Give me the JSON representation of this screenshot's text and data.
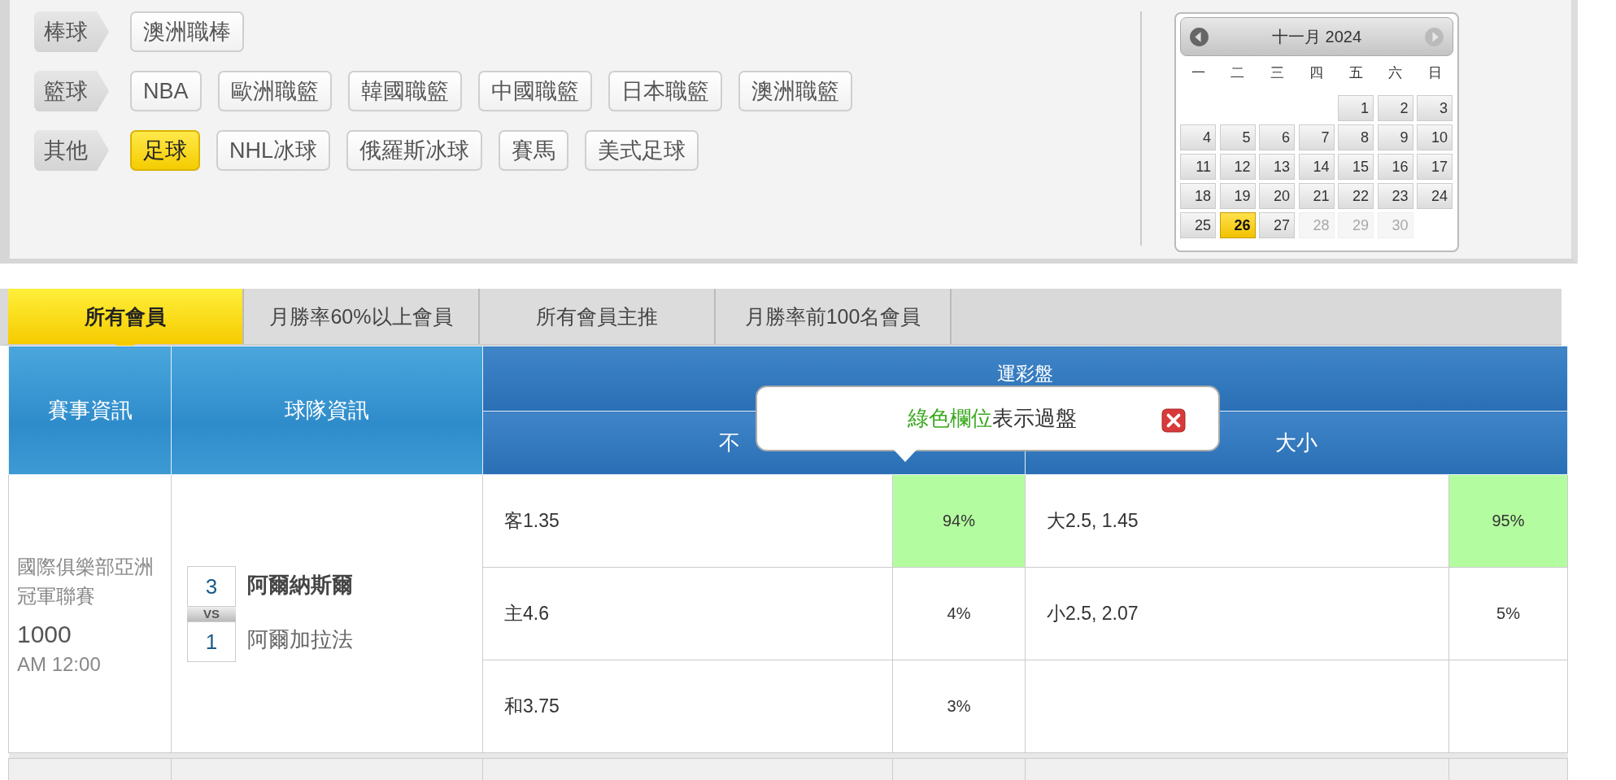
{
  "categories": [
    {
      "label": "棒球",
      "items": [
        {
          "label": "澳洲職棒",
          "selected": false
        }
      ]
    },
    {
      "label": "籃球",
      "items": [
        {
          "label": "NBA",
          "selected": false
        },
        {
          "label": "歐洲職籃",
          "selected": false
        },
        {
          "label": "韓國職籃",
          "selected": false
        },
        {
          "label": "中國職籃",
          "selected": false
        },
        {
          "label": "日本職籃",
          "selected": false
        },
        {
          "label": "澳洲職籃",
          "selected": false
        }
      ]
    },
    {
      "label": "其他",
      "items": [
        {
          "label": "足球",
          "selected": true
        },
        {
          "label": "NHL冰球",
          "selected": false
        },
        {
          "label": "俄羅斯冰球",
          "selected": false
        },
        {
          "label": "賽馬",
          "selected": false
        },
        {
          "label": "美式足球",
          "selected": false
        }
      ]
    }
  ],
  "calendar": {
    "title": "十一月 2024",
    "weekdays": [
      "一",
      "二",
      "三",
      "四",
      "五",
      "六",
      "日"
    ],
    "days": [
      {
        "kind": "blank"
      },
      {
        "kind": "blank"
      },
      {
        "kind": "blank"
      },
      {
        "kind": "blank"
      },
      {
        "kind": "day",
        "label": "1",
        "selected": false,
        "disabled": false
      },
      {
        "kind": "day",
        "label": "2",
        "selected": false,
        "disabled": false
      },
      {
        "kind": "day",
        "label": "3",
        "selected": false,
        "disabled": false
      },
      {
        "kind": "day",
        "label": "4",
        "selected": false,
        "disabled": false
      },
      {
        "kind": "day",
        "label": "5",
        "selected": false,
        "disabled": false
      },
      {
        "kind": "day",
        "label": "6",
        "selected": false,
        "disabled": false
      },
      {
        "kind": "day",
        "label": "7",
        "selected": false,
        "disabled": false
      },
      {
        "kind": "day",
        "label": "8",
        "selected": false,
        "disabled": false
      },
      {
        "kind": "day",
        "label": "9",
        "selected": false,
        "disabled": false
      },
      {
        "kind": "day",
        "label": "10",
        "selected": false,
        "disabled": false
      },
      {
        "kind": "day",
        "label": "11",
        "selected": false,
        "disabled": false
      },
      {
        "kind": "day",
        "label": "12",
        "selected": false,
        "disabled": false
      },
      {
        "kind": "day",
        "label": "13",
        "selected": false,
        "disabled": false
      },
      {
        "kind": "day",
        "label": "14",
        "selected": false,
        "disabled": false
      },
      {
        "kind": "day",
        "label": "15",
        "selected": false,
        "disabled": false
      },
      {
        "kind": "day",
        "label": "16",
        "selected": false,
        "disabled": false
      },
      {
        "kind": "day",
        "label": "17",
        "selected": false,
        "disabled": false
      },
      {
        "kind": "day",
        "label": "18",
        "selected": false,
        "disabled": false
      },
      {
        "kind": "day",
        "label": "19",
        "selected": false,
        "disabled": false
      },
      {
        "kind": "day",
        "label": "20",
        "selected": false,
        "disabled": false
      },
      {
        "kind": "day",
        "label": "21",
        "selected": false,
        "disabled": false
      },
      {
        "kind": "day",
        "label": "22",
        "selected": false,
        "disabled": false
      },
      {
        "kind": "day",
        "label": "23",
        "selected": false,
        "disabled": false
      },
      {
        "kind": "day",
        "label": "24",
        "selected": false,
        "disabled": false
      },
      {
        "kind": "day",
        "label": "25",
        "selected": false,
        "disabled": false
      },
      {
        "kind": "day",
        "label": "26",
        "selected": true,
        "disabled": false
      },
      {
        "kind": "day",
        "label": "27",
        "selected": false,
        "disabled": false
      },
      {
        "kind": "day",
        "label": "28",
        "selected": false,
        "disabled": true
      },
      {
        "kind": "day",
        "label": "29",
        "selected": false,
        "disabled": true
      },
      {
        "kind": "day",
        "label": "30",
        "selected": false,
        "disabled": true
      }
    ]
  },
  "tabs": [
    {
      "label": "所有會員",
      "selected": true
    },
    {
      "label": "月勝率60%以上會員",
      "selected": false
    },
    {
      "label": "所有會員主推",
      "selected": false
    },
    {
      "label": "月勝率前100名會員",
      "selected": false
    }
  ],
  "table": {
    "columns": [
      "賽事資訊",
      "球隊資訊"
    ],
    "group_header": "運彩盤",
    "sub_headers": [
      "不",
      "大小"
    ],
    "rows": [
      {
        "league": "國際俱樂部亞洲冠軍聯賽",
        "match_no": "1000",
        "time": "AM 12:00",
        "vs": "VS",
        "teams": [
          {
            "score": "3",
            "name": "阿爾納斯爾",
            "winner": true
          },
          {
            "score": "1",
            "name": "阿爾加拉法",
            "winner": false
          }
        ],
        "lines": [
          {
            "handicap": {
              "pick": "客1.35",
              "pct": "94%",
              "passed": true
            },
            "total": {
              "pick": "大2.5, 1.45",
              "pct": "95%",
              "passed": true
            }
          },
          {
            "handicap": {
              "pick": "主4.6",
              "pct": "4%",
              "passed": false
            },
            "total": {
              "pick": "小2.5, 2.07",
              "pct": "5%",
              "passed": false
            }
          },
          {
            "handicap": {
              "pick": "和3.75",
              "pct": "3%",
              "passed": false
            }
          }
        ]
      }
    ]
  },
  "tooltip": {
    "highlight": "綠色欄位",
    "text": "表示過盤"
  }
}
